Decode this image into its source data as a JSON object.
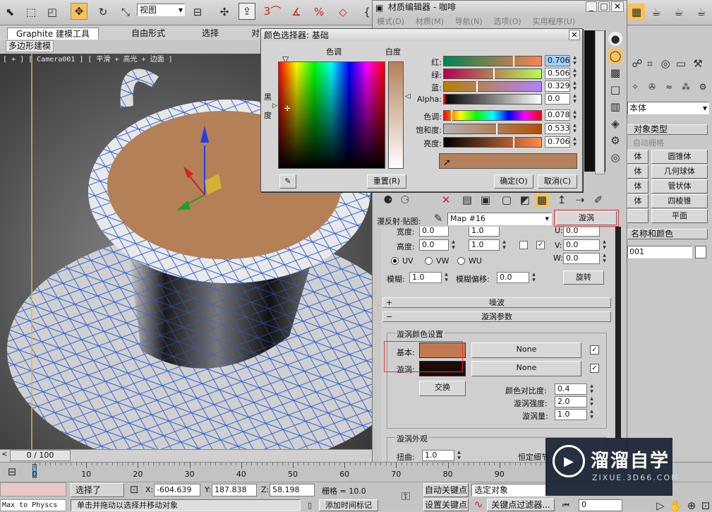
{
  "toolbar": {
    "viewport_select": "视图",
    "icons": [
      "select-object-icon",
      "rect-select-icon",
      "window-crossing-icon",
      "move-icon",
      "rotate-icon",
      "scale-icon",
      "dropdown-icon",
      "pivot-icon",
      "keyboard-shortcut-icon",
      "snap-3-icon",
      "angle-snap-icon",
      "percent-snap-icon",
      "spinner-snap-icon"
    ]
  },
  "ribbon": {
    "tabs": [
      "Graphite 建模工具",
      "自由形式",
      "选择",
      "对"
    ],
    "sub_tab": "多边形建模"
  },
  "viewport": {
    "label": "[ + ] [ Camera001 ] [ 平滑 + 高光 + 边面 ]"
  },
  "material_editor": {
    "title": "材质编辑器 - 咖啡",
    "menu": [
      "模式(D)",
      "材质(M)",
      "导航(N)",
      "选项(O)",
      "实用程序(U)"
    ],
    "diffuse_label": "漫反射·贴图:",
    "map_name": "Map #16",
    "map_type_button": "漩涡",
    "rows": {
      "width_label": "宽度:",
      "width_val1": "0.0",
      "width_val2": "1.0",
      "height_label": "高度:",
      "height_val1": "0.0",
      "height_val2": "1.0",
      "u_label": "U:",
      "u_val": "0.0",
      "v_label": "V:",
      "v_val": "0.0",
      "w_label": "W:",
      "w_val": "0.0",
      "uv": "UV",
      "vw": "VW",
      "wu": "WU",
      "blur_label": "模糊:",
      "blur_val": "1.0",
      "blur_offset_label": "模糊偏移:",
      "blur_offset_val": "0.0",
      "rotate_button": "旋转"
    },
    "rollout_noise": "噪波",
    "rollout_swirl": "漩涡参数",
    "swirl_group": "漩涡颜色设置",
    "base_label": "基本:",
    "base_color": "#c47a50",
    "swirl_label": "漩涡:",
    "swirl_color": "#1a0b08",
    "none1": "None",
    "none2": "None",
    "swap_button": "交换",
    "contrast_label": "颜色对比度:",
    "contrast_val": "0.4",
    "intensity_label": "漩涡强度:",
    "intensity_val": "2.0",
    "amount_label": "漩涡量:",
    "amount_val": "1.0",
    "appearance_group": "漩涡外观",
    "twist_label": "扭曲:",
    "twist_val": "1.0",
    "detail_label": "恒定细节"
  },
  "color_picker": {
    "title": "颜色选择器: 基础",
    "hue_label": "色调",
    "white_label": "白度",
    "black_label_1": "黑",
    "black_label_2": "度",
    "red_label": "红:",
    "red_val": "0.706",
    "green_label": "绿:",
    "green_val": "0.506",
    "blue_label": "蓝:",
    "blue_val": "0.329",
    "alpha_label": "Alpha:",
    "alpha_val": "0.0",
    "hue2_label": "色调:",
    "hue2_val": "0.078",
    "sat_label": "饱和度:",
    "sat_val": "0.533",
    "val_label": "亮度:",
    "val_val": "0.706",
    "reset_button": "重置(R)",
    "ok_button": "确定(O)",
    "cancel_button": "取消(C)",
    "swatch_color": "#b4815a",
    "red": 0.706,
    "green": 0.506,
    "blue": 0.329,
    "alpha": 0.0,
    "hue": 0.078,
    "saturation": 0.533,
    "value": 0.706
  },
  "command_panel": {
    "dropdown": "本体",
    "object_type": "对象类型",
    "auto_grid": "自动栅格",
    "buttons": [
      [
        "体",
        "圆锥体"
      ],
      [
        "体",
        "几何球体"
      ],
      [
        "体",
        "管状体"
      ],
      [
        "体",
        "四棱锥"
      ],
      [
        "",
        "平面"
      ]
    ],
    "name_color": "名称和颜色",
    "name_value": "001"
  },
  "timeline": {
    "frame": "0 / 100",
    "ticks": [
      "0",
      "10",
      "20",
      "30",
      "40",
      "50",
      "60",
      "70",
      "80",
      "90"
    ]
  },
  "status": {
    "selected": "选择了",
    "x_label": "X:",
    "x_val": "-604.639",
    "y_label": "Y:",
    "y_val": "187.838",
    "z_label": "Z:",
    "z_val": "58.198",
    "grid": "栅格 = 10.0",
    "auto_key": "自动关键点",
    "set_key": "设置关键点",
    "selected_obj": "选定对象",
    "key_filter": "关键点过滤器...",
    "add_time_tag": "添加时间标记",
    "prompt": "单击并拖动以选择并移动对象",
    "max_to_physc": "Max to Physcs",
    "frame_input": "0"
  },
  "watermark": {
    "title": "溜溜自学",
    "url": "ZIXUE.3D66.COM"
  }
}
